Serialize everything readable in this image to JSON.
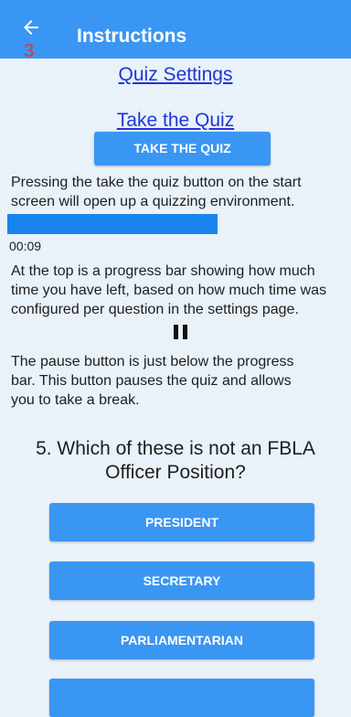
{
  "header": {
    "title": "Instructions",
    "badge": "3",
    "back_icon": "arrow-left-icon",
    "color": "#3a96f3"
  },
  "links": {
    "quiz_settings": "Quiz Settings",
    "take_the_quiz": "Take the Quiz"
  },
  "take_quiz_button": "TAKE THE QUIZ",
  "paragraphs": {
    "start": "Pressing the take the quiz button on the start screen will open up a quizzing environment.",
    "progress": "At the top is a progress bar showing how much time you have left, based on how much time was configured per question in the settings page.",
    "pause": "The pause button is just below the progress bar. This button pauses the quiz and allows you to take a break."
  },
  "progress_bar": {
    "color": "#1a84ee"
  },
  "timer": "00:09",
  "pause_icon": "pause-icon",
  "question": "5. Which of these is not an FBLA Officer Position?",
  "answers": [
    "PRESIDENT",
    "SECRETARY",
    "PARLIAMENTARIAN"
  ]
}
